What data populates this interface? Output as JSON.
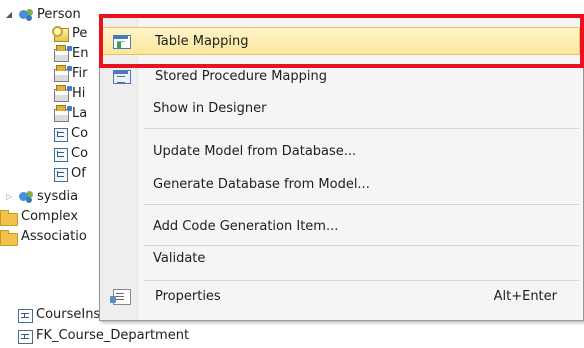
{
  "tree": {
    "items": [
      {
        "label": "Person",
        "icon": "entity-set-icon",
        "toggle": "expanded"
      },
      {
        "label": "Pe",
        "icon": "key-property-icon"
      },
      {
        "label": "En",
        "icon": "property-icon"
      },
      {
        "label": "Fir",
        "icon": "property-icon"
      },
      {
        "label": "Hi",
        "icon": "property-icon"
      },
      {
        "label": "La",
        "icon": "property-icon"
      },
      {
        "label": "Co",
        "icon": "navigation-property-icon"
      },
      {
        "label": "Co",
        "icon": "navigation-property-icon"
      },
      {
        "label": "Of",
        "icon": "navigation-property-icon"
      },
      {
        "label": "sysdia",
        "icon": "entity-set-icon",
        "toggle": "collapsed"
      },
      {
        "label": "Complex",
        "icon": "folder-icon"
      },
      {
        "label": "Associatio",
        "icon": "folder-icon"
      },
      {
        "label": "CourseInstructor",
        "icon": "association-icon"
      },
      {
        "label": "FK_Course_Department",
        "icon": "association-icon"
      }
    ]
  },
  "context_menu": {
    "items": [
      {
        "label": "Table Mapping",
        "icon": "table-mapping-icon",
        "shortcut": "",
        "highlighted": true
      },
      {
        "label": "Stored Procedure Mapping",
        "icon": "stored-procedure-mapping-icon",
        "shortcut": ""
      },
      {
        "label": "Show in Designer",
        "icon": "",
        "shortcut": ""
      },
      {
        "label": "Update Model from Database...",
        "icon": "",
        "shortcut": ""
      },
      {
        "label": "Generate Database from Model...",
        "icon": "",
        "shortcut": ""
      },
      {
        "label": "Add Code Generation Item...",
        "icon": "",
        "shortcut": ""
      },
      {
        "label": "Validate",
        "icon": "",
        "shortcut": ""
      },
      {
        "label": "Properties",
        "icon": "properties-icon",
        "shortcut": "Alt+Enter"
      }
    ]
  },
  "colors": {
    "highlight_fill": "#fbe79a",
    "highlight_border": "#e5c365",
    "callout": "#e8121e",
    "menu_background": "#f5f5f5"
  }
}
